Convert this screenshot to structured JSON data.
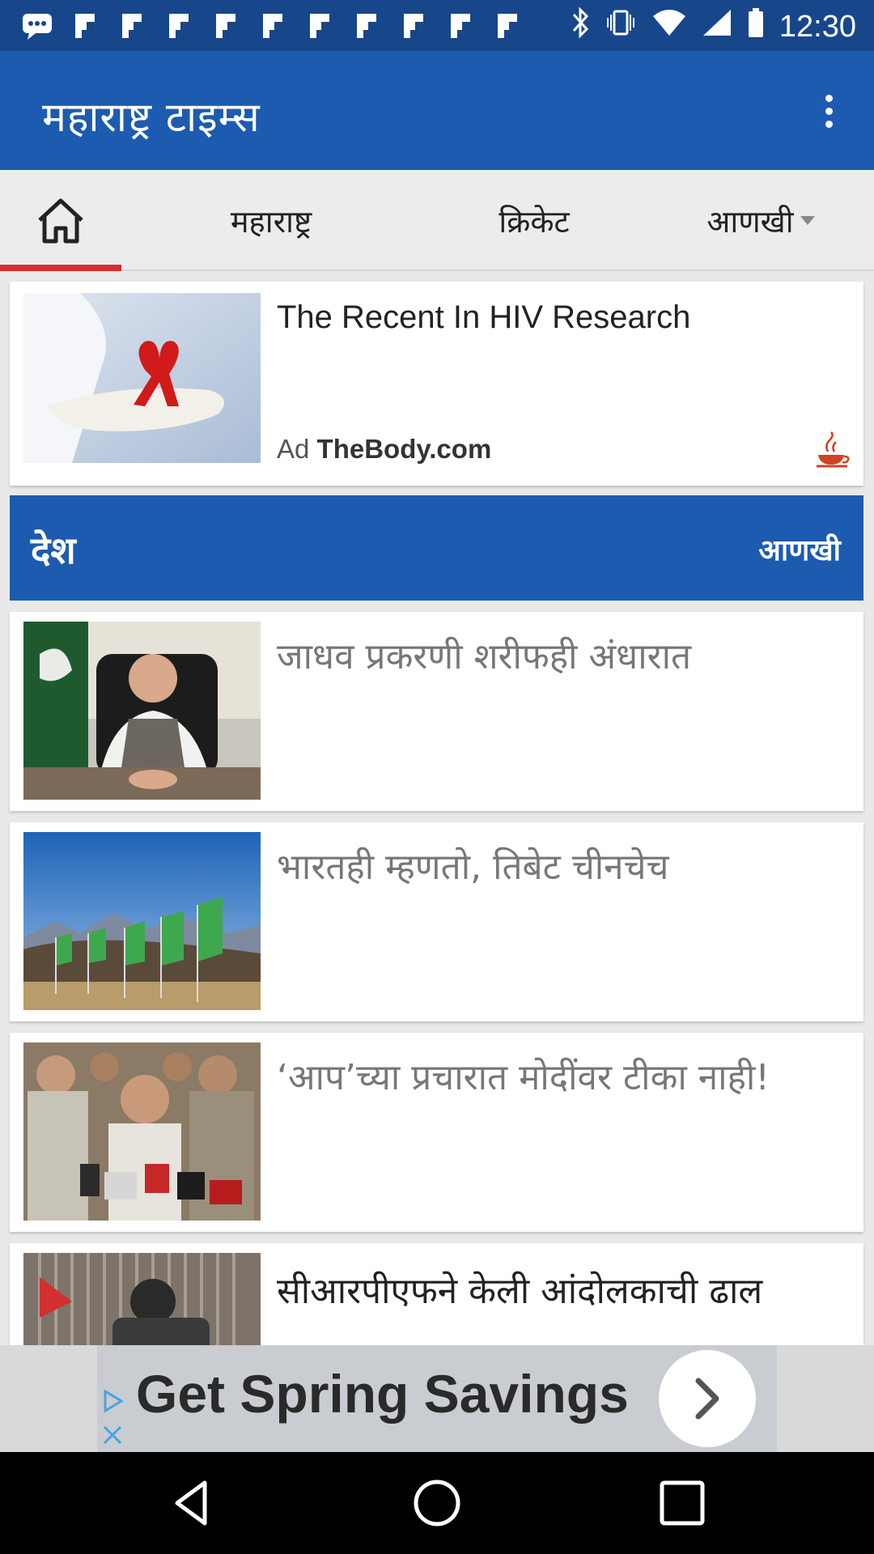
{
  "status_bar": {
    "time": "12:30",
    "notification_icons": [
      "chat-icon",
      "flipboard-icon",
      "flipboard-icon",
      "flipboard-icon",
      "flipboard-icon",
      "flipboard-icon",
      "flipboard-icon",
      "flipboard-icon",
      "flipboard-icon",
      "flipboard-icon",
      "flipboard-icon"
    ],
    "right_icons": [
      "bluetooth-icon",
      "vibrate-icon",
      "wifi-icon",
      "signal-icon",
      "battery-icon"
    ]
  },
  "app_bar": {
    "title": "महाराष्ट्र टाइम्स",
    "menu_icon": "overflow-menu-icon"
  },
  "tabs": [
    {
      "icon": "home-icon",
      "active": true
    },
    {
      "label": "महाराष्ट्र"
    },
    {
      "label": "क्रिकेट"
    },
    {
      "label": "आणखी",
      "dropdown": true
    }
  ],
  "ad_card": {
    "headline": "The Recent In HIV Research",
    "badge": "Ad",
    "source": "TheBody.com",
    "image": "hand-with-red-ribbon"
  },
  "section": {
    "title": "देश",
    "more_label": "आणखी"
  },
  "articles": [
    {
      "title": "जाधव प्रकरणी शरीफही अंधारात",
      "image": "man-seated-with-flag"
    },
    {
      "title": "भारतही म्हणतो, तिबेट चीनचेच",
      "image": "green-flags-mountains"
    },
    {
      "title": "‘आप’च्या प्रचारात मोदींवर टीका नाही!",
      "image": "press-microphones"
    },
    {
      "title": "सीआरपीएफने केली आंदोलकाची ढाल",
      "image": "man-on-vehicle"
    }
  ],
  "bottom_ad": {
    "text": "Get Spring Savings"
  },
  "colors": {
    "primary": "#1d5bb0",
    "status_bar": "#17478a",
    "tab_indicator": "#d32f2f"
  }
}
